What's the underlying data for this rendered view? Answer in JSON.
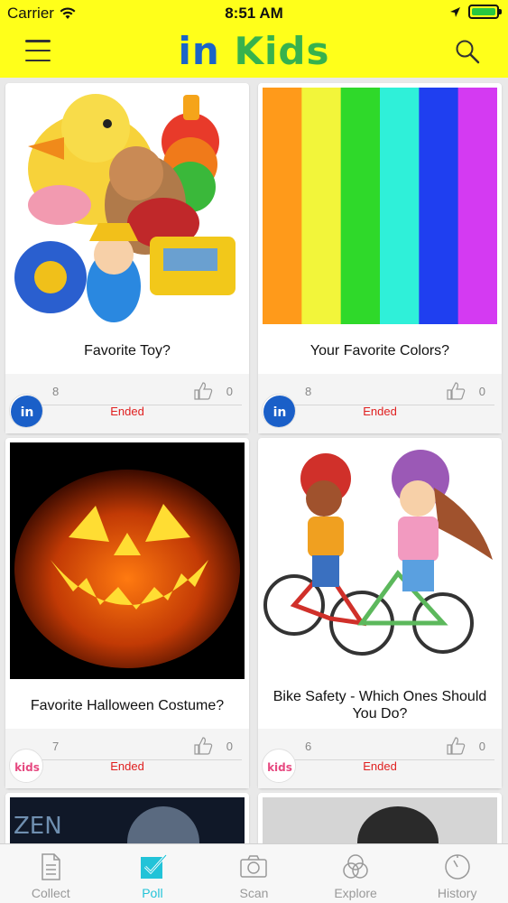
{
  "status": {
    "carrier": "Carrier",
    "time": "8:51 AM"
  },
  "header": {
    "logo_part1": "in",
    "logo_part2": "Kids"
  },
  "polls": [
    {
      "title": "Favorite Toy?",
      "voters": "8",
      "likes": "0",
      "status": "Ended",
      "image": "toys-pile"
    },
    {
      "title": "Your Favorite Colors?",
      "voters": "8",
      "likes": "0",
      "status": "Ended",
      "image": "color-stripes"
    },
    {
      "title": "Favorite Halloween Costume?",
      "voters": "7",
      "likes": "0",
      "status": "Ended",
      "image": "jack-o-lantern"
    },
    {
      "title": "Bike Safety - Which Ones Should You Do?",
      "voters": "6",
      "likes": "0",
      "status": "Ended",
      "image": "kids-on-bikes"
    },
    {
      "title": "",
      "image": "dark-photo"
    },
    {
      "title": "",
      "image": "dark-photo-2"
    }
  ],
  "colors": {
    "header_bg": "#ffff1a",
    "tab_active": "#22c3d8",
    "ended_red": "#e02020",
    "stripes": [
      "#ff9a1a",
      "#f2f53a",
      "#2fd92a",
      "#2ff0d9",
      "#1f3ff0",
      "#d43af2"
    ]
  },
  "tabbar": {
    "tabs": [
      {
        "label": "Collect",
        "icon": "document-icon",
        "active": false
      },
      {
        "label": "Poll",
        "icon": "checkbox-icon",
        "active": true
      },
      {
        "label": "Scan",
        "icon": "camera-icon",
        "active": false
      },
      {
        "label": "Explore",
        "icon": "circles-icon",
        "active": false
      },
      {
        "label": "History",
        "icon": "clock-icon",
        "active": false
      }
    ]
  }
}
